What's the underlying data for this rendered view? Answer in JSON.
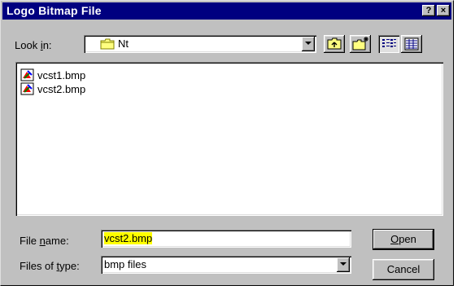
{
  "dialog": {
    "title": "Logo Bitmap File",
    "help_glyph": "?",
    "close_glyph": "×"
  },
  "look_in": {
    "label_prefix": "Look ",
    "label_access": "i",
    "label_suffix": "n:",
    "value": "Nt"
  },
  "files": [
    {
      "name": "vcst1.bmp",
      "icon": "bitmap-file-icon"
    },
    {
      "name": "vcst2.bmp",
      "icon": "bitmap-file-icon"
    }
  ],
  "file_name": {
    "label_prefix": "File ",
    "label_access": "n",
    "label_suffix": "ame:",
    "value": "vcst2.bmp"
  },
  "file_type": {
    "label_prefix": "Files of ",
    "label_access": "t",
    "label_suffix": "ype:",
    "value": "bmp files"
  },
  "buttons": {
    "open_access": "O",
    "open_rest": "pen",
    "cancel": "Cancel"
  },
  "colors": {
    "titlebar": "#000080",
    "face": "#c0c0c0",
    "selection_highlight": "#ffff00"
  }
}
